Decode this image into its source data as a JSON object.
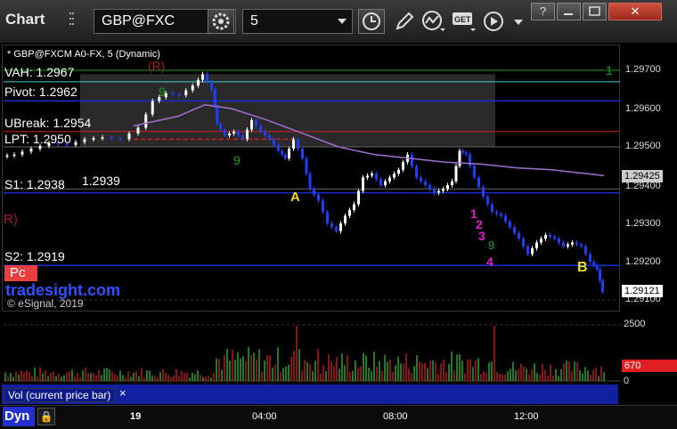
{
  "toolbar": {
    "app_title": "Chart",
    "symbol": "GBP@FXC",
    "interval": "5",
    "help_label": "?",
    "minimize_label": "",
    "restore_label": "",
    "close_label": "✕"
  },
  "chart": {
    "header": "* GBP@FXCM A0-FX, 5 (Dynamic)",
    "levels": {
      "vah": "VAH: 1.2967",
      "pivot": "Pivot: 1.2962",
      "ubreak": "UBreak: 1.2954",
      "lpt": "LPT: 1.2950",
      "s1": "S1: 1.2938",
      "s1_extra": "1.2939",
      "s2": "S2: 1.2919"
    },
    "markers": {
      "r_top": "(R)",
      "r_left": "R)",
      "a": "A",
      "b": "B",
      "n1": "1",
      "n2": "2",
      "n3": "3",
      "n4": "4",
      "nine_a": "9",
      "nine_b": "9",
      "nine_c": "9",
      "one_green": "1"
    },
    "pc_label": "Pc",
    "watermark": "tradesight.com",
    "copyright": "© eSignal, 2019",
    "price_axis": [
      "1.29700",
      "1.29600",
      "1.29500",
      "1.29400",
      "1.29300",
      "1.29200",
      "1.29100"
    ],
    "current_price": "1.29121",
    "avg_price": "1.29425",
    "time_axis": [
      "19",
      "04:00",
      "08:00",
      "12:00"
    ]
  },
  "volume": {
    "label": "Vol (current price bar)",
    "close": "×",
    "axis": [
      "2500",
      "0"
    ],
    "current": "670"
  },
  "bottom": {
    "dyn_label": "Dyn"
  },
  "colors": {
    "up": "#ffffff",
    "down": "#1f3fff",
    "vol_up": "#2fa02f",
    "vol_down": "#b02020",
    "vah_line": "#40d0d0",
    "pivot_line": "#1a2bd0",
    "ubreak_line": "#d02020",
    "avg_line": "#a070d0",
    "green_line": "#1a9a1a"
  }
}
